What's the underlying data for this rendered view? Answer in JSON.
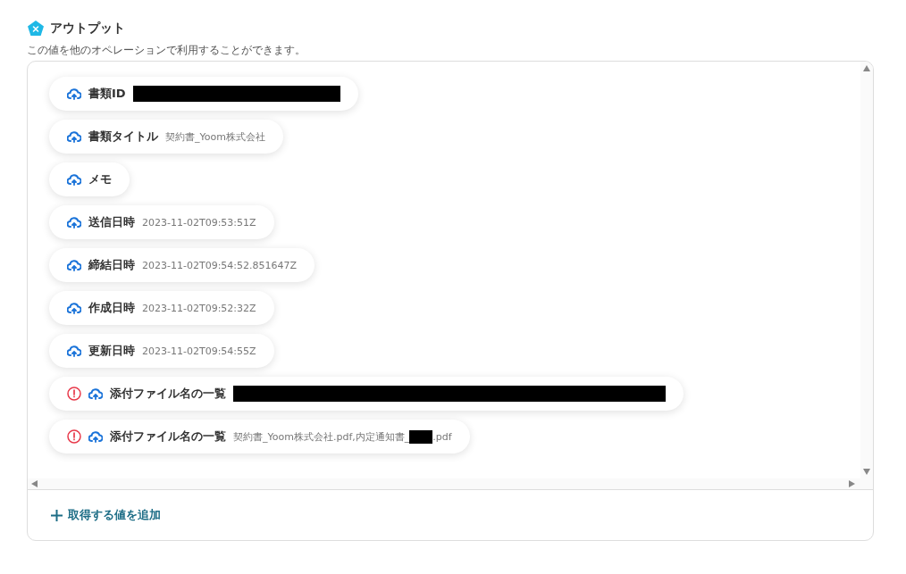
{
  "title": "アウトプット",
  "subtitle": "この値を他のオペレーションで利用することができます。",
  "outputs": [
    {
      "label": "書類ID",
      "warning": false,
      "parts": [
        {
          "kind": "redaction"
        }
      ]
    },
    {
      "label": "書類タイトル",
      "warning": false,
      "parts": [
        {
          "kind": "text",
          "text": "契約書_Yoom株式会社"
        }
      ]
    },
    {
      "label": "メモ",
      "warning": false
    },
    {
      "label": "送信日時",
      "warning": false,
      "parts": [
        {
          "kind": "text",
          "text": "2023-11-02T09:53:51Z"
        }
      ]
    },
    {
      "label": "締結日時",
      "warning": false,
      "parts": [
        {
          "kind": "text",
          "text": "2023-11-02T09:54:52.851647Z"
        }
      ]
    },
    {
      "label": "作成日時",
      "warning": false,
      "parts": [
        {
          "kind": "text",
          "text": "2023-11-02T09:52:32Z"
        }
      ]
    },
    {
      "label": "更新日時",
      "warning": false,
      "parts": [
        {
          "kind": "text",
          "text": "2023-11-02T09:54:55Z"
        }
      ]
    },
    {
      "label": "添付ファイル名の一覧",
      "warning": true,
      "parts": [
        {
          "kind": "redaction"
        }
      ]
    },
    {
      "label": "添付ファイル名の一覧",
      "warning": true,
      "parts": [
        {
          "kind": "text",
          "text": "契約書_Yoom株式会社.pdf,内定通知書_"
        },
        {
          "kind": "redaction"
        },
        {
          "kind": "text",
          "text": ".pdf"
        }
      ]
    }
  ],
  "add_button": "取得する値を追加"
}
